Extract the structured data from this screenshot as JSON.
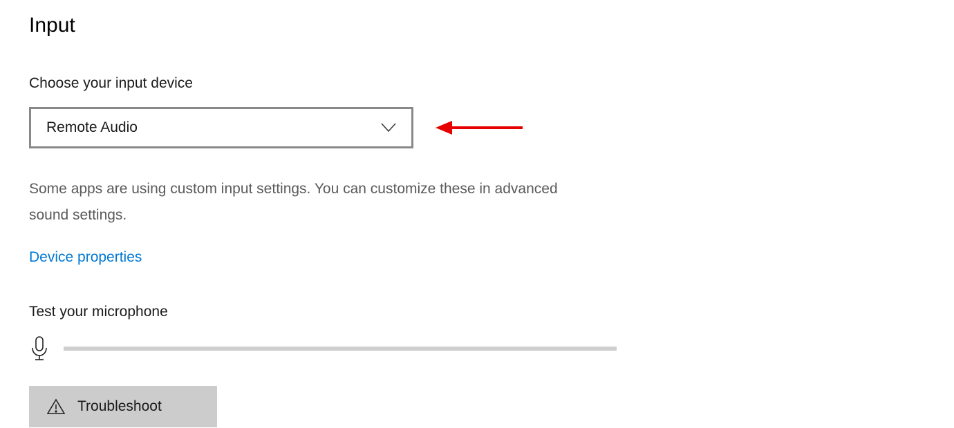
{
  "section": {
    "title": "Input",
    "choose_label": "Choose your input device",
    "dropdown_value": "Remote Audio",
    "help_text": "Some apps are using custom input settings. You can customize these in advanced sound settings.",
    "device_props_link": "Device properties",
    "test_mic_label": "Test your microphone",
    "troubleshoot_label": "Troubleshoot"
  },
  "annotation": {
    "arrow_color": "#e60000"
  }
}
